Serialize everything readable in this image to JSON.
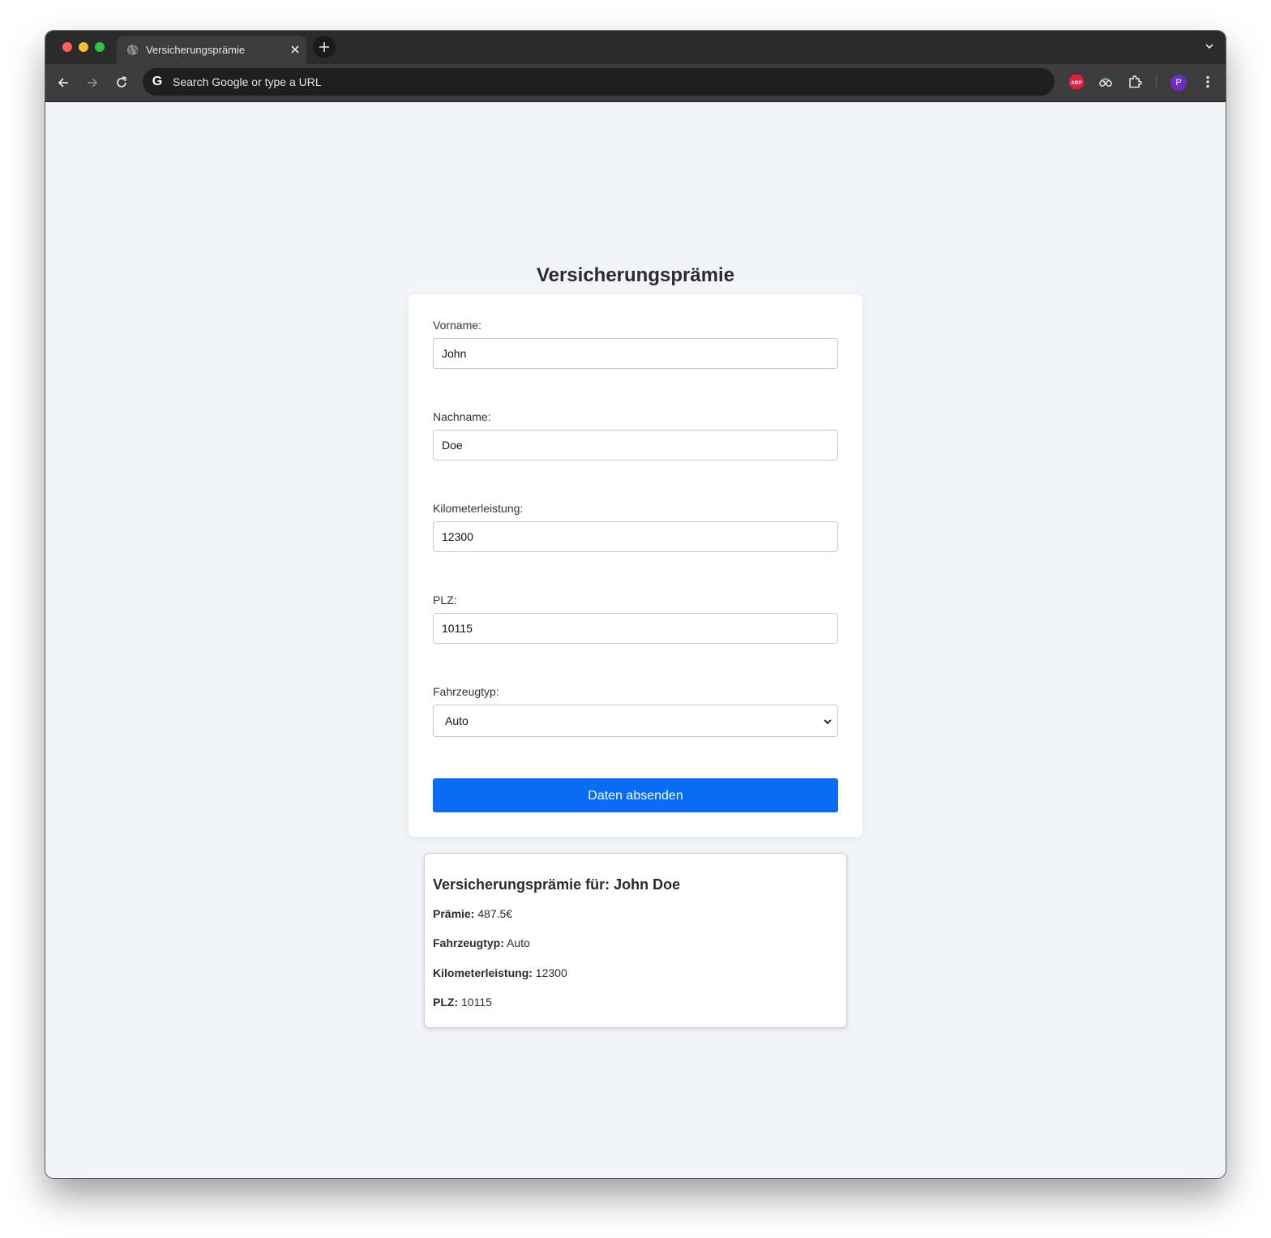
{
  "browser": {
    "tab_title": "Versicherungsprämie",
    "omnibox_placeholder": "Search Google or type a URL",
    "avatar_letter": "P",
    "abp_label": "ABP"
  },
  "page": {
    "title": "Versicherungsprämie",
    "form": {
      "first_name_label": "Vorname:",
      "first_name_value": "John",
      "last_name_label": "Nachname:",
      "last_name_value": "Doe",
      "mileage_label": "Kilometerleistung:",
      "mileage_value": "12300",
      "zip_label": "PLZ:",
      "zip_value": "10115",
      "vehicle_label": "Fahrzeugtyp:",
      "vehicle_value": "Auto",
      "submit_label": "Daten absenden"
    },
    "result": {
      "title": "Versicherungsprämie für: John Doe",
      "premium_label": "Prämie:",
      "premium_value": "487.5€",
      "vehicle_label": "Fahrzeugtyp:",
      "vehicle_value": "Auto",
      "mileage_label": "Kilometerleistung:",
      "mileage_value": "12300",
      "zip_label": "PLZ:",
      "zip_value": "10115"
    }
  },
  "colors": {
    "accent": "#0a6cf5",
    "page_background": "#f1f4f9",
    "chrome_dark": "#2b2b2b"
  }
}
